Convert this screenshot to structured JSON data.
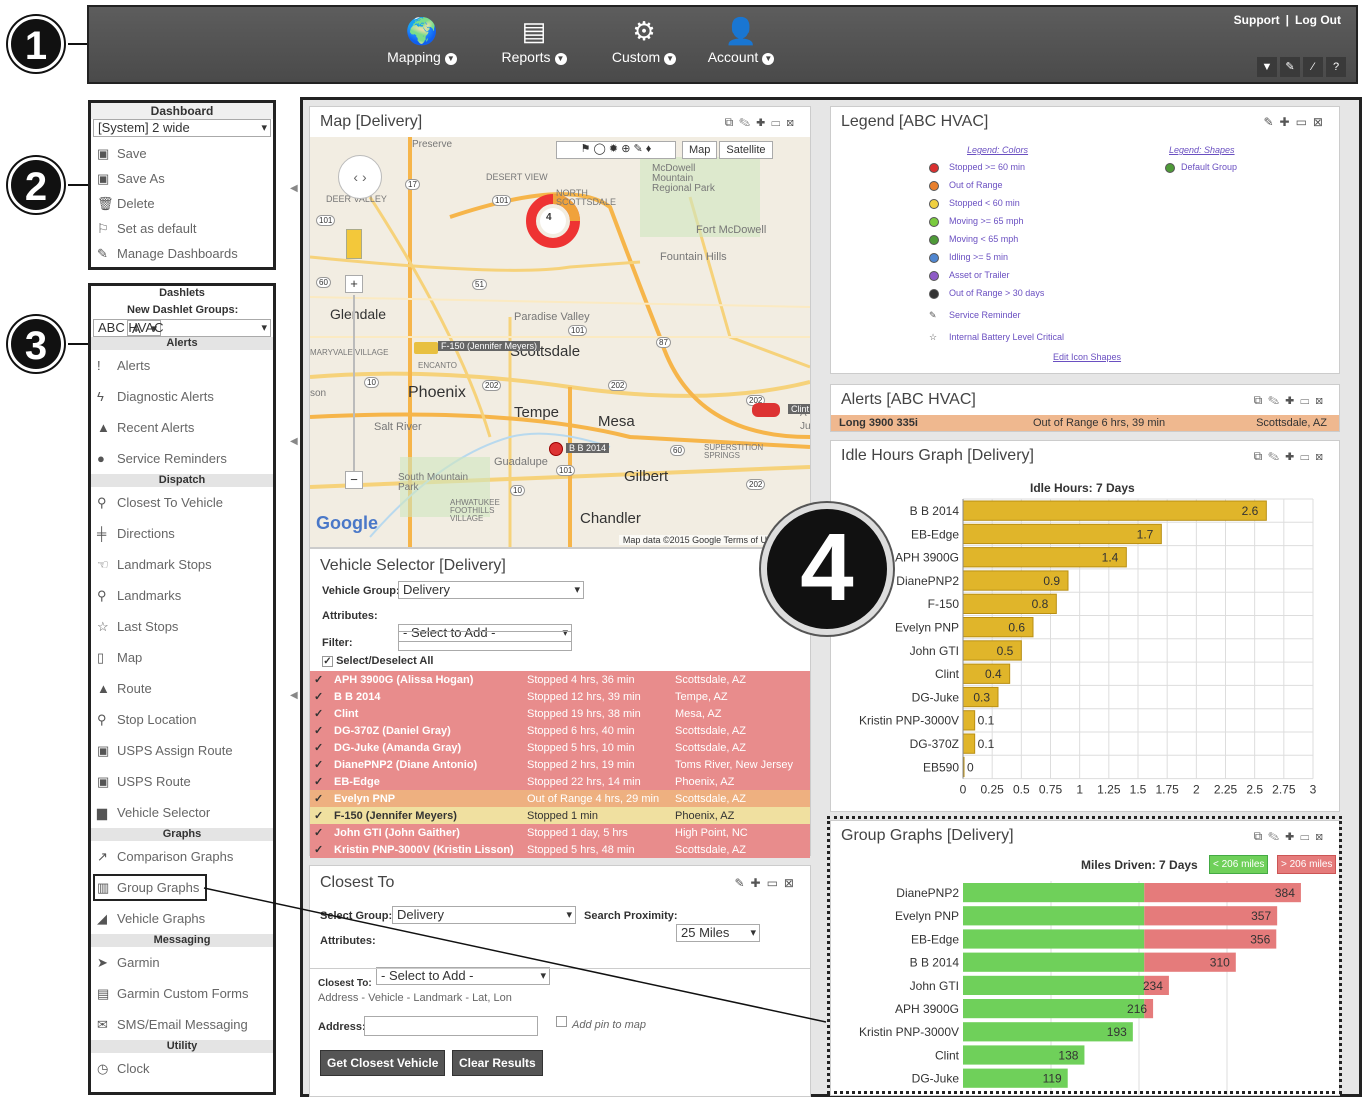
{
  "topbar": {
    "nav": [
      {
        "label": "Mapping",
        "icon": "globe-icon"
      },
      {
        "label": "Reports",
        "icon": "reports-icon"
      },
      {
        "label": "Custom",
        "icon": "gears-icon"
      },
      {
        "label": "Account",
        "icon": "user-icon"
      }
    ],
    "support": "Support",
    "separator": "|",
    "logout": "Log Out",
    "tools": [
      "filter-icon",
      "wrench-icon",
      "edit-icon",
      "help-icon"
    ],
    "tool_glyph_help": "?"
  },
  "callouts": [
    "1",
    "2",
    "3",
    "4"
  ],
  "dashboard": {
    "title": "Dashboard",
    "selected": "[System] 2 wide",
    "items": [
      {
        "label": "Save",
        "icon": "save-icon"
      },
      {
        "label": "Save As",
        "icon": "save-as-icon"
      },
      {
        "label": "Delete",
        "icon": "trash-icon"
      },
      {
        "label": "Set as default",
        "icon": "bookmark-icon"
      },
      {
        "label": "Manage Dashboards",
        "icon": "wrench-icon"
      }
    ]
  },
  "dashlets": {
    "title": "Dashlets",
    "new_groups_label": "New Dashlet Groups:",
    "new_groups_value": "A",
    "group": "ABC HVAC",
    "sections": [
      {
        "title": "Alerts",
        "items": [
          {
            "label": "Alerts",
            "icon": "exclamation-icon"
          },
          {
            "label": "Diagnostic Alerts",
            "icon": "lightning-icon"
          },
          {
            "label": "Recent Alerts",
            "icon": "warning-icon"
          },
          {
            "label": "Service Reminders",
            "icon": "info-circle-icon"
          }
        ]
      },
      {
        "title": "Dispatch",
        "items": [
          {
            "label": "Closest To Vehicle",
            "icon": "search-icon"
          },
          {
            "label": "Directions",
            "icon": "signpost-icon"
          },
          {
            "label": "Landmark Stops",
            "icon": "hand-icon"
          },
          {
            "label": "Landmarks",
            "icon": "pin-icon"
          },
          {
            "label": "Last Stops",
            "icon": "star-icon"
          },
          {
            "label": "Map",
            "icon": "map-icon"
          },
          {
            "label": "Route",
            "icon": "road-icon"
          },
          {
            "label": "Stop Location",
            "icon": "pushpin-icon"
          },
          {
            "label": "USPS Assign Route",
            "icon": "mailbox-icon"
          },
          {
            "label": "USPS Route",
            "icon": "mailbox-icon"
          },
          {
            "label": "Vehicle Selector",
            "icon": "truck-icon"
          }
        ]
      },
      {
        "title": "Graphs",
        "items": [
          {
            "label": "Comparison Graphs",
            "icon": "line-chart-icon"
          },
          {
            "label": "Group Graphs",
            "icon": "bar-chart-icon"
          },
          {
            "label": "Vehicle Graphs",
            "icon": "area-chart-icon"
          }
        ]
      },
      {
        "title": "Messaging",
        "items": [
          {
            "label": "Garmin",
            "icon": "arrow-icon"
          },
          {
            "label": "Garmin Custom Forms",
            "icon": "form-icon"
          },
          {
            "label": "SMS/Email Messaging",
            "icon": "envelope-icon"
          }
        ]
      },
      {
        "title": "Utility",
        "items": [
          {
            "label": "Clock",
            "icon": "clock-icon"
          }
        ]
      }
    ]
  },
  "map": {
    "title": "Map  [Delivery]",
    "map_btn": "Map",
    "satellite_btn": "Satellite",
    "cluster_count": "4",
    "labels": [
      {
        "text": "Preserve"
      },
      {
        "text": "DESERT VIEW"
      },
      {
        "text": "McDowell Mountain Regional Park"
      },
      {
        "text": "NORTH SCOTTSDALE"
      },
      {
        "text": "Fort McDowell"
      },
      {
        "text": "Fountain Hills"
      },
      {
        "text": "DEER VALLEY"
      },
      {
        "text": "Glendale"
      },
      {
        "text": "Paradise Valley"
      },
      {
        "text": "Scottsdale"
      },
      {
        "text": "MARYVALE VILLAGE"
      },
      {
        "text": "ENCANTO"
      },
      {
        "text": "Phoenix"
      },
      {
        "text": "Tempe"
      },
      {
        "text": "Mesa"
      },
      {
        "text": "Salt River"
      },
      {
        "text": "Guadalupe"
      },
      {
        "text": "Gilbert"
      },
      {
        "text": "South Mountain Park"
      },
      {
        "text": "AHWATUKEE FOOTHILLS VILLAGE"
      },
      {
        "text": "Chandler"
      },
      {
        "text": "SUPERSTITION SPRINGS"
      },
      {
        "text": "son"
      },
      {
        "text": "Ju"
      },
      {
        "text": "A"
      }
    ],
    "highway_shields": [
      "17",
      "101",
      "101",
      "51",
      "60",
      "202",
      "202",
      "87",
      "10",
      "202",
      "60",
      "202",
      "101",
      "10",
      "101"
    ],
    "vehicle_tags": [
      "F-150 (Jennifer Meyers)",
      "B B 2014",
      "Clint"
    ],
    "attribution": "Map data ©2015 Google   Terms of Use   Report",
    "google": "Google"
  },
  "vehicle_selector": {
    "title": "Vehicle Selector  [Delivery]",
    "group_label": "Vehicle Group:",
    "group_value": "Delivery",
    "attr_label": "Attributes:",
    "attr_value": "- Select to Add -",
    "filter_label": "Filter:",
    "select_all": "Select/Deselect All",
    "rows": [
      {
        "name": "APH 3900G (Alissa Hogan)",
        "status": "Stopped 4 hrs, 36 min",
        "loc": "Scottsdale, AZ",
        "color": "#e88c8c"
      },
      {
        "name": "B B 2014",
        "status": "Stopped 12 hrs, 39 min",
        "loc": "Tempe, AZ",
        "color": "#e88c8c"
      },
      {
        "name": "Clint",
        "status": "Stopped 19 hrs, 38 min",
        "loc": "Mesa, AZ",
        "color": "#e88c8c"
      },
      {
        "name": "DG-370Z (Daniel Gray)",
        "status": "Stopped 6 hrs, 40 min",
        "loc": "Scottsdale, AZ",
        "color": "#e88c8c"
      },
      {
        "name": "DG-Juke (Amanda Gray)",
        "status": "Stopped 5 hrs, 10 min",
        "loc": "Scottsdale, AZ",
        "color": "#e88c8c"
      },
      {
        "name": "DianePNP2 (Diane Antonio)",
        "status": "Stopped 2 hrs, 19 min",
        "loc": "Toms River, New Jersey",
        "color": "#e88c8c"
      },
      {
        "name": "EB-Edge",
        "status": "Stopped 22 hrs, 14 min",
        "loc": "Phoenix, AZ",
        "color": "#e88c8c"
      },
      {
        "name": "Evelyn PNP",
        "status": "Out of Range 4 hrs, 29 min",
        "loc": "Scottsdale, AZ",
        "color": "#eeb080"
      },
      {
        "name": "F-150 (Jennifer Meyers)",
        "status": "Stopped 1 min",
        "loc": "Phoenix, AZ",
        "color": "#f0e0a0"
      },
      {
        "name": "John GTI (John Gaither)",
        "status": "Stopped 1 day, 5 hrs",
        "loc": "High Point, NC",
        "color": "#e88c8c"
      },
      {
        "name": "Kristin PNP-3000V (Kristin Lisson)",
        "status": "Stopped 5 hrs, 48 min",
        "loc": "Scottsdale, AZ",
        "color": "#e88c8c"
      }
    ]
  },
  "closest": {
    "title": "Closest To",
    "group_label": "Select Group:",
    "group_value": "Delivery",
    "prox_label": "Search Proximity:",
    "prox_value": "25 Miles",
    "attr_label": "Attributes:",
    "attr_value": "- Select to Add -",
    "closest_to_label": "Closest To:",
    "options": "Address  -  Vehicle  -  Landmark  -  Lat, Lon",
    "address_label": "Address:",
    "pin_label": "Add pin to map",
    "btn_get": "Get Closest Vehicle",
    "btn_clear": "Clear Results"
  },
  "legend": {
    "title": "Legend  [ABC HVAC]",
    "colors_title": "Legend: Colors",
    "shapes_title": "Legend: Shapes",
    "colors": [
      {
        "label": "Stopped >= 60 min",
        "color": "#d93030"
      },
      {
        "label": "Out of Range",
        "color": "#e87f2c"
      },
      {
        "label": "Stopped < 60 min",
        "color": "#f0d040"
      },
      {
        "label": "Moving >= 65 mph",
        "color": "#7acb3e"
      },
      {
        "label": "Moving < 65 mph",
        "color": "#4e9a38"
      },
      {
        "label": "Idling >= 5 min",
        "color": "#4f86d0"
      },
      {
        "label": "Asset or Trailer",
        "color": "#8e5bc6"
      },
      {
        "label": "Out of Range > 30 days",
        "color": "#333333"
      }
    ],
    "service_reminder": "Service Reminder",
    "battery": "Internal Battery Level Critical",
    "edit_link": "Edit Icon Shapes",
    "shape_default": "Default Group"
  },
  "alerts": {
    "title": "Alerts  [ABC HVAC]",
    "row": {
      "vehicle": "Long 3900 335i",
      "status": "Out of Range 6 hrs, 39 min",
      "loc": "Scottsdale, AZ"
    }
  },
  "chart_data": [
    {
      "type": "bar",
      "title": "Idle Hours: 7 Days",
      "panel_title": "Idle Hours Graph  [Delivery]",
      "categories": [
        "B B 2014",
        "EB-Edge",
        "APH 3900G",
        "DianePNP2",
        "F-150",
        "Evelyn PNP",
        "John GTI",
        "Clint",
        "DG-Juke",
        "Kristin PNP-3000V",
        "DG-370Z",
        "EB590"
      ],
      "category_labels_drawn": [
        "B B 2014",
        "EB-Edge",
        "APH 3900G",
        "DianePNP2",
        "F-150",
        "Evelyn PNP",
        "John GTI",
        "Clint",
        "DG-Juke",
        "Kristin PNP-3000V",
        "DG-370Z",
        "EB590"
      ],
      "values": [
        2.6,
        1.7,
        1.4,
        0.9,
        0.8,
        0.6,
        0.5,
        0.4,
        0.3,
        0.1,
        0.1,
        0
      ],
      "xlim": [
        0,
        3
      ],
      "xticks": [
        "0",
        "0.25",
        "0.5",
        "0.75",
        "1",
        "1.25",
        "1.5",
        "1.75",
        "2",
        "2.25",
        "2.5",
        "2.75",
        "3"
      ],
      "color": "#e0b52a",
      "grid": true
    },
    {
      "type": "bar",
      "title": "Miles Driven: 7 Days",
      "panel_title": "Group Graphs  [Delivery]",
      "legend": [
        "< 206 miles",
        "> 206 miles"
      ],
      "threshold": 206,
      "categories": [
        "DianePNP2",
        "Evelyn PNP",
        "EB-Edge",
        "B B 2014",
        "John GTI",
        "APH 3900G",
        "Kristin PNP-3000V",
        "Clint",
        "DG-Juke"
      ],
      "values": [
        384,
        357,
        356,
        310,
        234,
        216,
        193,
        138,
        119
      ],
      "xlim": [
        0,
        400
      ],
      "colors": {
        "below": "#6fd05a",
        "above": "#e57b7b"
      }
    }
  ]
}
